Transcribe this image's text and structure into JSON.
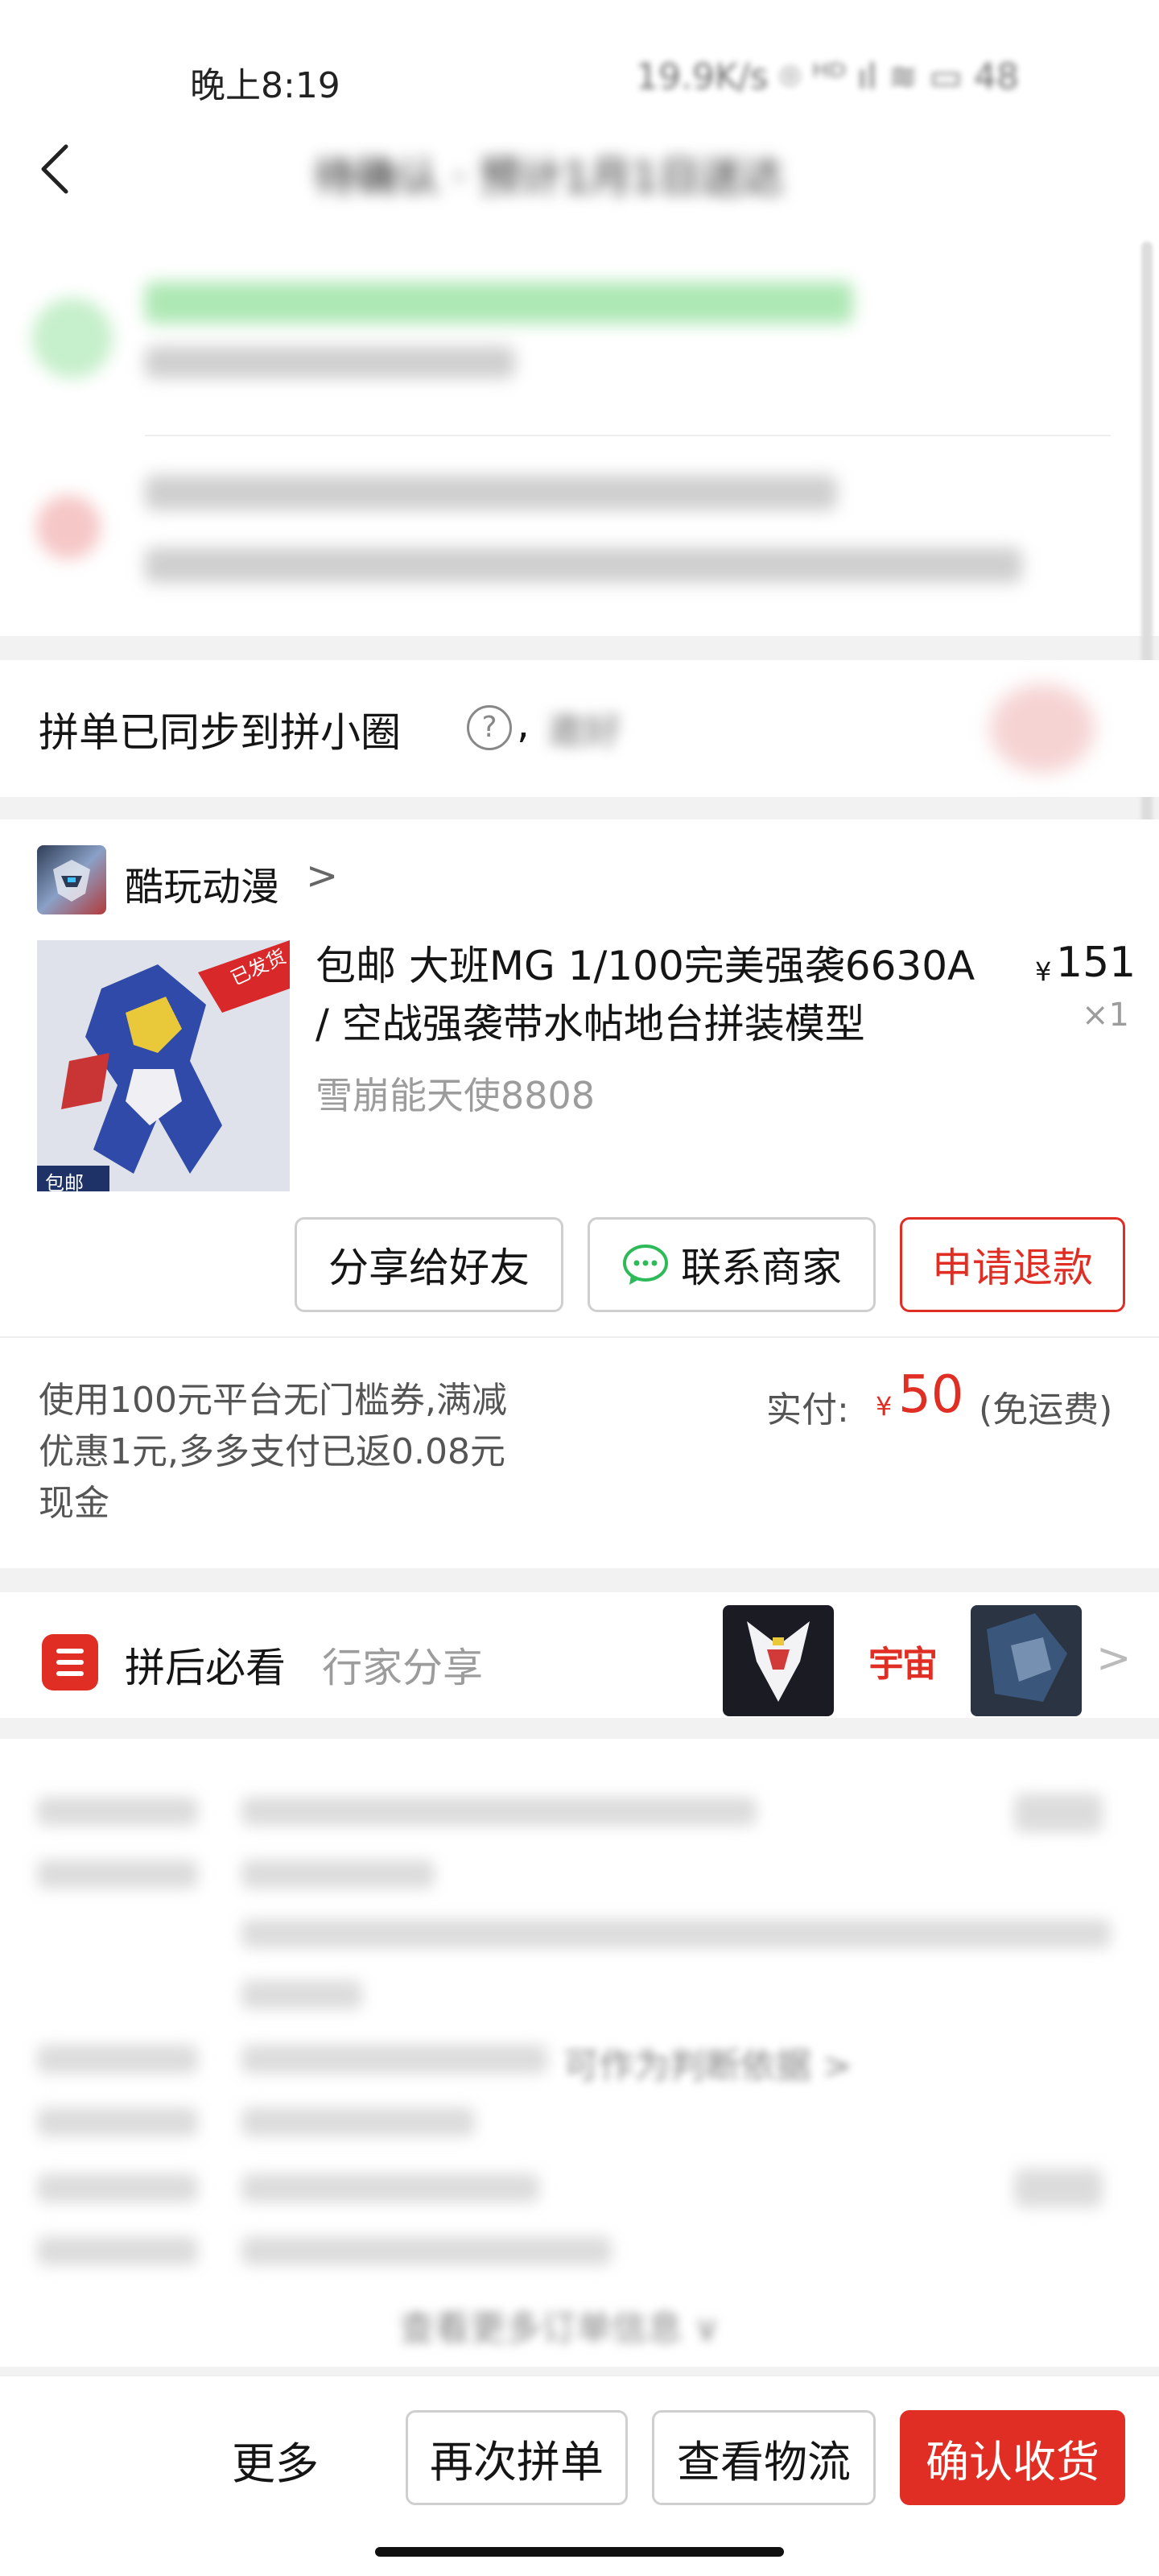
{
  "status_bar": {
    "time": "晚上8:19",
    "right": "19.9K/s ⌾ ᴴᴰ ıl ≋ ▭ 48"
  },
  "nav": {
    "title": "待确认 · 预计1月1日送达"
  },
  "sync": {
    "text": "拼单已同步到拼小圈",
    "help": "?",
    "comma": ",",
    "extra": "邀好"
  },
  "shop": {
    "name": "酷玩动漫",
    "chevron": ">"
  },
  "product": {
    "title": "包邮 大班MG 1/100完美强袭6630A / 空战强袭带水帖地台拼装模型",
    "spec": "雪崩能天使8808",
    "price_symbol": "¥",
    "price": "151",
    "quantity": "×1",
    "image_badge": "已发货",
    "image_tag": "包邮"
  },
  "actions": {
    "share": "分享给好友",
    "contact": "联系商家",
    "refund": "申请退款"
  },
  "payment": {
    "discount_text": "使用100元平台无门槛券,满减优惠1元,多多支付已返0.08元现金",
    "paid_label": "实付:",
    "paid_symbol": "¥",
    "paid_value": "50",
    "paid_note": "(免运费)"
  },
  "must_see": {
    "title": "拼后必看",
    "subtitle": "行家分享",
    "thumb_text": "宇宙",
    "chevron": ">"
  },
  "details": {
    "blurred_link": "可作为判断依据 >",
    "blurred_more": "查看更多订单信息 ∨"
  },
  "bottom": {
    "more": "更多",
    "reorder": "再次拼单",
    "logistics": "查看物流",
    "confirm": "确认收货"
  },
  "colors": {
    "brand_red": "#e02e24",
    "green": "#2fba5a"
  }
}
